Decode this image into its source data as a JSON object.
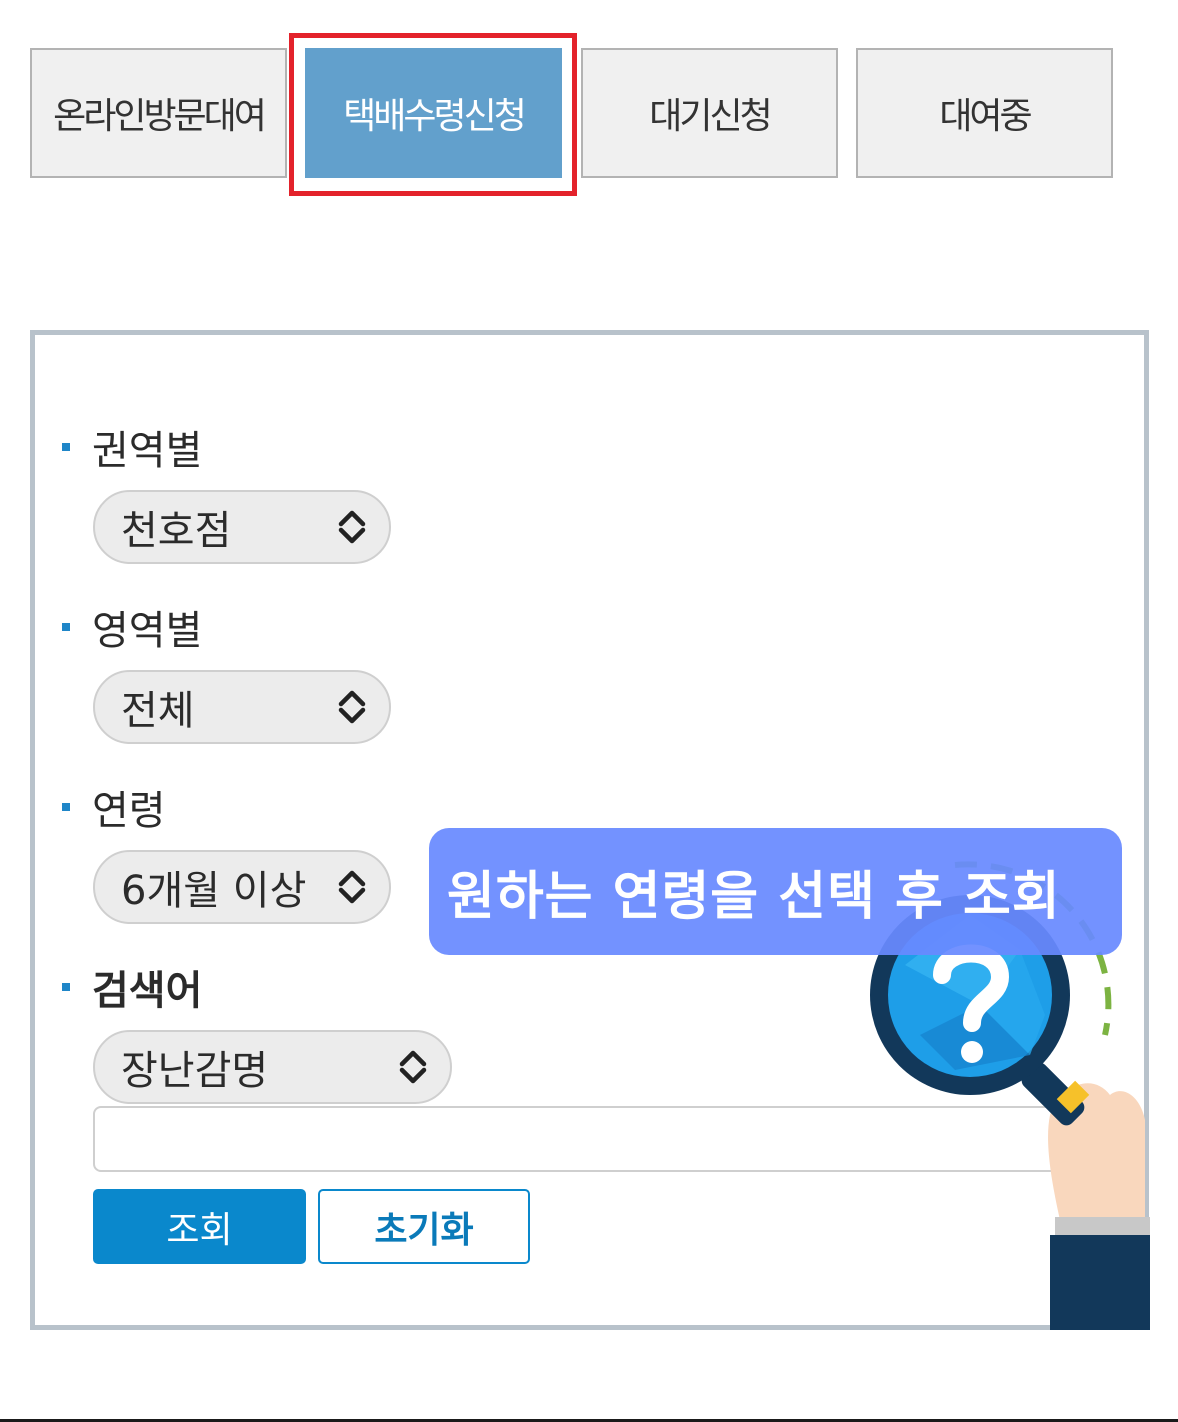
{
  "tabs": [
    {
      "label": "온라인방문대여",
      "active": false
    },
    {
      "label": "택배수령신청",
      "active": true
    },
    {
      "label": "대기신청",
      "active": false
    },
    {
      "label": "대여중",
      "active": false
    }
  ],
  "filters": {
    "region": {
      "label": "권역별",
      "selected": "천호점"
    },
    "category": {
      "label": "영역별",
      "selected": "전체"
    },
    "age": {
      "label": "연령",
      "selected": "6개월 이상"
    },
    "keyword": {
      "label": "검색어",
      "selected": "장난감명",
      "value": "",
      "placeholder": ""
    }
  },
  "buttons": {
    "search": "조회",
    "reset": "초기화"
  },
  "callout": {
    "text": "원하는 연령을 선택 후 조회"
  },
  "colors": {
    "active_tab": "#62a0cc",
    "highlight": "#e3222b",
    "primary": "#0a88cc",
    "callout": "#688aff"
  },
  "icons": {
    "select_arrow": "chevron-up-down-icon",
    "illustration": "magnifier-question-icon"
  }
}
